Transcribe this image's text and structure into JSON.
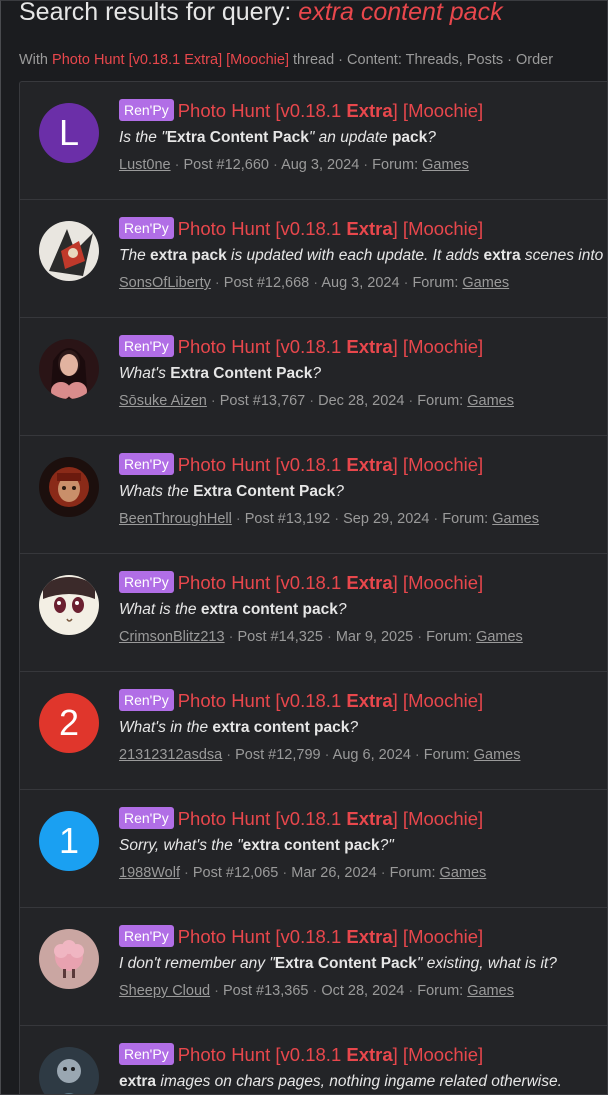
{
  "header": {
    "title_prefix": "Search results for query: ",
    "query": "extra content pack",
    "filter_prefix": "With ",
    "filter_thread": "Photo Hunt [v0.18.1 Extra] [Moochie]",
    "filter_suffix": " thread · Content: Threads, Posts · Order"
  },
  "title_parts": {
    "badge": "Ren'Py",
    "t1": "Photo Hunt [v0.18.1 ",
    "t2": "Extra",
    "t3": "] [Moochie]"
  },
  "results": [
    {
      "avatar": {
        "type": "letter",
        "letter": "L",
        "color": "#6b2fa8"
      },
      "snippet": [
        [
          "Is the \"",
          0
        ],
        [
          "Extra Content Pack",
          1
        ],
        [
          "\" an update ",
          0
        ],
        [
          "pack",
          1
        ],
        [
          "?",
          0
        ]
      ],
      "user": "Lust0ne",
      "post": "Post #12,660",
      "date": "Aug 3, 2024",
      "forum_label": "Forum: ",
      "forum": "Games"
    },
    {
      "avatar": {
        "type": "image",
        "icon": "mech-art-avatar"
      },
      "snippet": [
        [
          "The ",
          0
        ],
        [
          "extra pack",
          1
        ],
        [
          " is updated with each update. It adds ",
          0
        ],
        [
          "extra",
          1
        ],
        [
          " scenes into",
          0
        ]
      ],
      "user": "SonsOfLiberty",
      "post": "Post #12,668",
      "date": "Aug 3, 2024",
      "forum_label": "Forum: ",
      "forum": "Games"
    },
    {
      "avatar": {
        "type": "image",
        "icon": "woman-portrait-avatar"
      },
      "snippet": [
        [
          "What's ",
          0
        ],
        [
          "Extra Content Pack",
          1
        ],
        [
          "?",
          0
        ]
      ],
      "user": "Sōsuke Aizen",
      "post": "Post #13,767",
      "date": "Dec 28, 2024",
      "forum_label": "Forum: ",
      "forum": "Games"
    },
    {
      "avatar": {
        "type": "image",
        "icon": "red-hair-avatar"
      },
      "snippet": [
        [
          "Whats the ",
          0
        ],
        [
          "Extra Content Pack",
          1
        ],
        [
          "?",
          0
        ]
      ],
      "user": "BeenThroughHell",
      "post": "Post #13,192",
      "date": "Sep 29, 2024",
      "forum_label": "Forum: ",
      "forum": "Games"
    },
    {
      "avatar": {
        "type": "image",
        "icon": "anime-face-avatar"
      },
      "snippet": [
        [
          "What is the ",
          0
        ],
        [
          "extra content pack",
          1
        ],
        [
          "?",
          0
        ]
      ],
      "user": "CrimsonBlitz213",
      "post": "Post #14,325",
      "date": "Mar 9, 2025",
      "forum_label": "Forum: ",
      "forum": "Games"
    },
    {
      "avatar": {
        "type": "letter",
        "letter": "2",
        "color": "#e0362c"
      },
      "snippet": [
        [
          "What's in the ",
          0
        ],
        [
          "extra content pack",
          1
        ],
        [
          "?",
          0
        ]
      ],
      "user": "21312312asdsa",
      "post": "Post #12,799",
      "date": "Aug 6, 2024",
      "forum_label": "Forum: ",
      "forum": "Games"
    },
    {
      "avatar": {
        "type": "letter",
        "letter": "1",
        "color": "#1aa0f2"
      },
      "snippet": [
        [
          "Sorry, what's the \"",
          0
        ],
        [
          "extra content pack",
          1
        ],
        [
          "?\"",
          0
        ]
      ],
      "user": "1988Wolf",
      "post": "Post #12,065",
      "date": "Mar 26, 2024",
      "forum_label": "Forum: ",
      "forum": "Games"
    },
    {
      "avatar": {
        "type": "image",
        "icon": "pink-sheep-avatar"
      },
      "snippet": [
        [
          "I don't remember any \"",
          0
        ],
        [
          "Extra Content Pack",
          1
        ],
        [
          "\" existing, what is it?",
          0
        ]
      ],
      "user": "Sheepy Cloud",
      "post": "Post #13,365",
      "date": "Oct 28, 2024",
      "forum_label": "Forum: ",
      "forum": "Games"
    },
    {
      "avatar": {
        "type": "image",
        "icon": "character-art-avatar"
      },
      "snippet": [
        [
          "extra",
          1
        ],
        [
          " images on chars pages, nothing ingame related otherwise.",
          0
        ]
      ],
      "user": "",
      "post": "",
      "date": "",
      "forum_label": "",
      "forum": ""
    }
  ],
  "colors": {
    "accent": "#e8474c",
    "badge": "#b16ee6",
    "background": "#1b1c1f",
    "panel": "#232427"
  }
}
